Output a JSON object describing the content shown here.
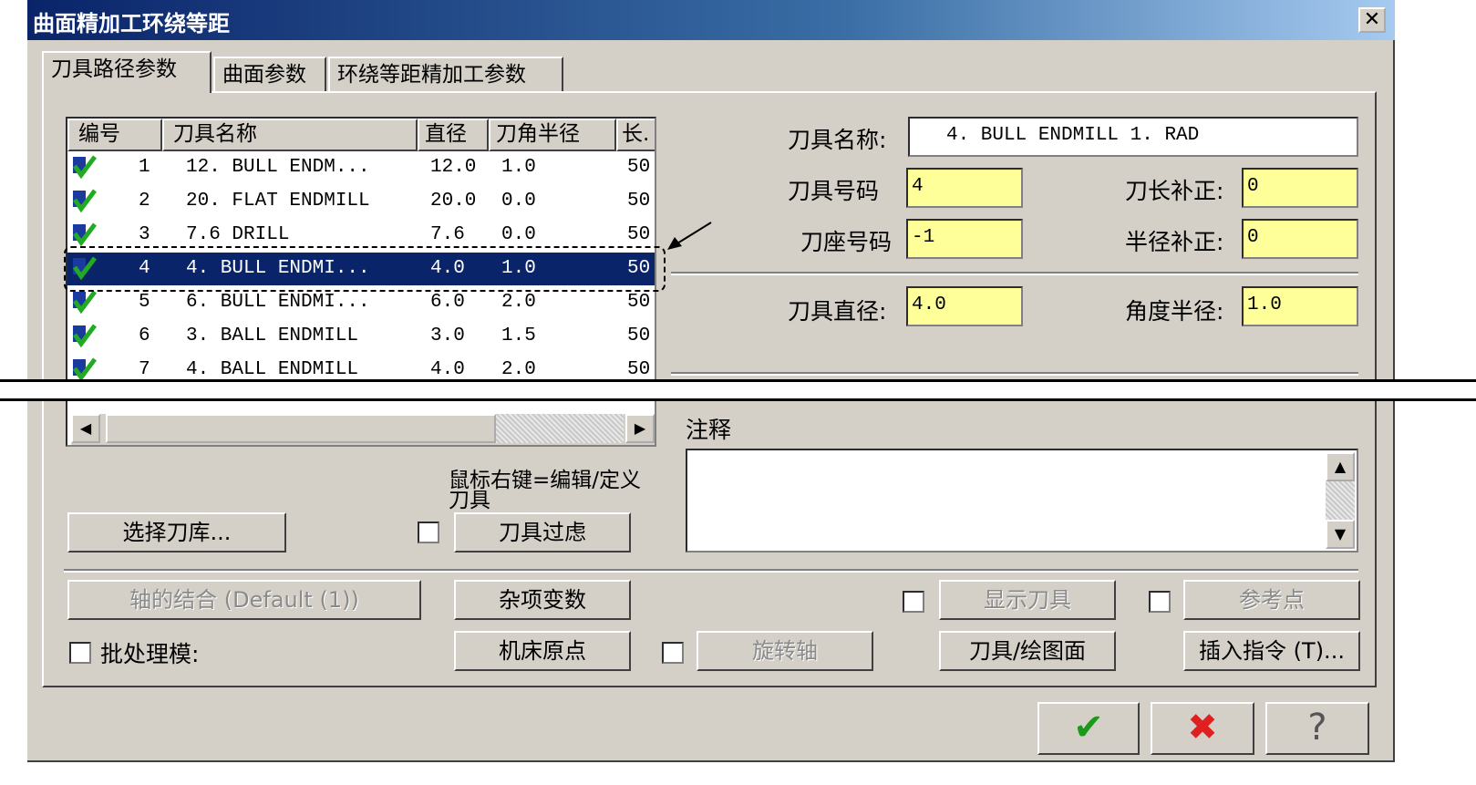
{
  "title": "曲面精加工环绕等距",
  "close_label": "✕",
  "tabs": [
    "刀具路径参数",
    "曲面参数",
    "环绕等距精加工参数"
  ],
  "tool_list": {
    "headers": [
      "编号",
      "刀具名称",
      "直径",
      "刀角半径",
      "长."
    ],
    "rows": [
      {
        "num": "1",
        "name": "12. BULL ENDM...",
        "dia": "12.0",
        "rad": "1.0",
        "len": "50"
      },
      {
        "num": "2",
        "name": "20. FLAT ENDMILL",
        "dia": "20.0",
        "rad": "0.0",
        "len": "50"
      },
      {
        "num": "3",
        "name": "7.6 DRILL",
        "dia": "7.6",
        "rad": "0.0",
        "len": "50"
      },
      {
        "num": "4",
        "name": "4. BULL ENDMI...",
        "dia": "4.0",
        "rad": "1.0",
        "len": "50"
      },
      {
        "num": "5",
        "name": "6. BULL ENDMI...",
        "dia": "6.0",
        "rad": "2.0",
        "len": "50"
      },
      {
        "num": "6",
        "name": "3. BALL ENDMILL",
        "dia": "3.0",
        "rad": "1.5",
        "len": "50"
      },
      {
        "num": "7",
        "name": "4. BALL ENDMILL",
        "dia": "4.0",
        "rad": "2.0",
        "len": "50"
      }
    ],
    "selected_row": 3
  },
  "fields": {
    "tool_name_label": "刀具名称:",
    "tool_name_value": "4. BULL ENDMILL 1. RAD",
    "tool_num_label": "刀具号码",
    "tool_num_value": "4",
    "length_comp_label": "刀长补正:",
    "length_comp_value": "0",
    "holder_num_label": "刀座号码",
    "holder_num_value": "-1",
    "radius_comp_label": "半径补正:",
    "radius_comp_value": "0",
    "diameter_label": "刀具直径:",
    "diameter_value": "4.0",
    "corner_radius_label": "角度半径:",
    "corner_radius_value": "1.0"
  },
  "notes_label": "注释",
  "hint": "鼠标右键=编辑/定义 刀具",
  "buttons": {
    "select_library": "选择刀库...",
    "tool_filter": "刀具过虑",
    "axis_combo": "轴的结合 (Default (1))",
    "misc_values": "杂项变数",
    "show_tool": "显示刀具",
    "ref_point": "参考点",
    "machine_origin": "机床原点",
    "rotary_axis": "旋转轴",
    "tool_plane": "刀具/绘图面",
    "insert_command": "插入指令 (T)..."
  },
  "batch_label": "批处理模:",
  "dialog_buttons": {
    "ok": "✔",
    "cancel": "✖",
    "help": "?"
  },
  "colors": {
    "selection": "#0a246a",
    "field_yellow": "#ffff99",
    "ok_green": "#1a9a1a",
    "cancel_red": "#e02020"
  }
}
